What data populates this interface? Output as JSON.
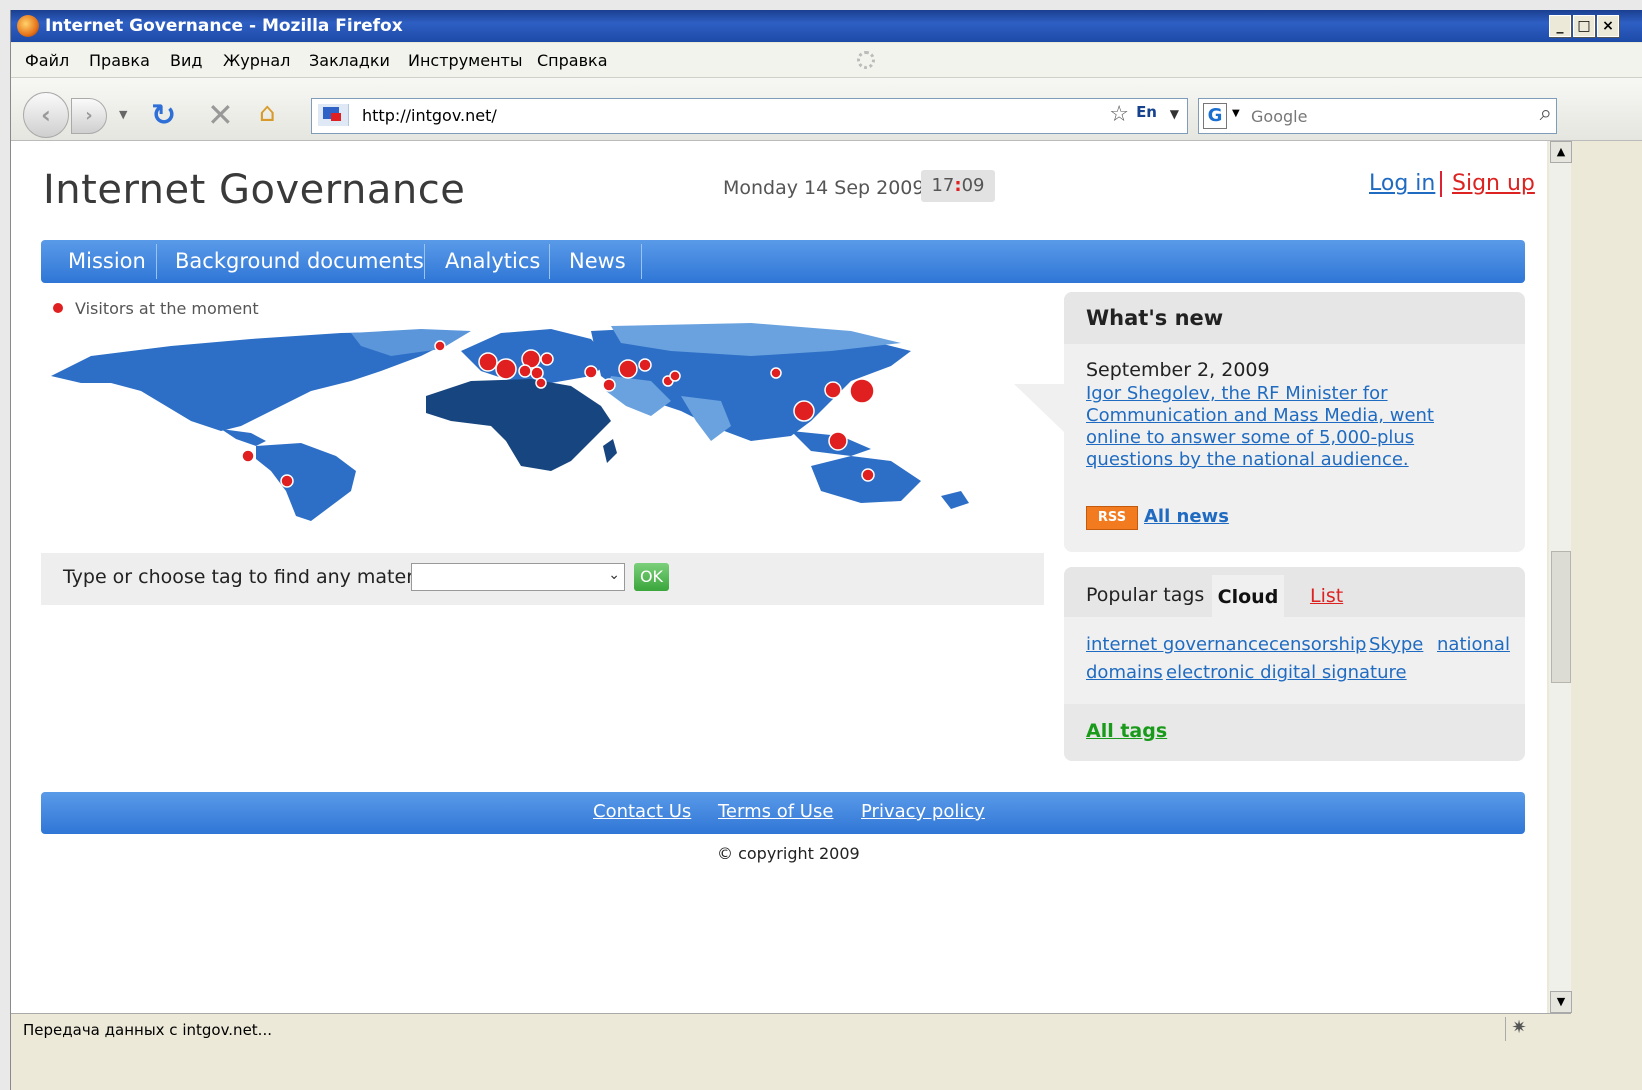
{
  "window": {
    "title": "Internet Governance - Mozilla Firefox"
  },
  "menubar": {
    "items": [
      "Файл",
      "Правка",
      "Вид",
      "Журнал",
      "Закладки",
      "Инструменты",
      "Справка"
    ]
  },
  "navbar": {
    "url": "http://intgov.net/",
    "lang": "En",
    "search_placeholder": "Google",
    "search_engine_label": "G"
  },
  "page": {
    "site_title": "Internet Governance",
    "date": "Monday 14 Sep 2009",
    "clock": {
      "hours": "17",
      "colon": ":",
      "minutes": "09"
    },
    "auth": {
      "login": "Log in",
      "signup": "Sign up"
    },
    "nav": [
      "Mission",
      "Background documents",
      "Analytics",
      "News"
    ],
    "visitors_label": "Visitors at the moment",
    "tag_search": {
      "label": "Type or choose tag to find any materials",
      "selected": "",
      "button": "OK"
    },
    "whats_new": {
      "title": "What's new",
      "date": "September 2, 2009",
      "text": "Igor Shegolev, the RF Minister for Communication and Mass Media, went online to answer some of 5,000-plus questions by the national audience.",
      "rss": "RSS",
      "all_news": "All news"
    },
    "tags": {
      "label": "Popular tags",
      "tab_cloud": "Cloud",
      "tab_list": "List",
      "items": [
        "internet governance",
        "censorship",
        "Skype",
        "national",
        "domains",
        "electronic digital signature"
      ],
      "all_tags": "All tags"
    },
    "footer": {
      "links": [
        "Contact Us",
        "Terms of Use",
        "Privacy policy"
      ],
      "copyright": "© copyright 2009"
    }
  },
  "statusbar": {
    "text": "Передача данных с intgov.net..."
  },
  "colors": {
    "nav_blue": "#2f76d6",
    "link_blue": "#1f6bc1",
    "accent_red": "#e02020",
    "ok_green": "#3aa53a",
    "rss_orange": "#f27b20"
  }
}
